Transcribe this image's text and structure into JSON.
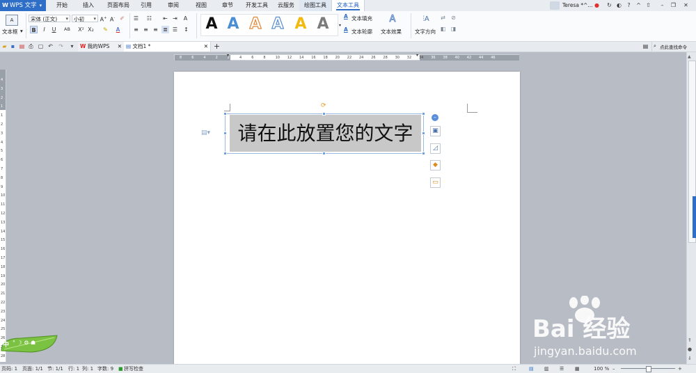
{
  "app": {
    "name": "WPS 文字",
    "user": "Teresa *^..."
  },
  "menu": [
    "开始",
    "插入",
    "页面布局",
    "引用",
    "审阅",
    "视图",
    "章节",
    "开发工具",
    "云服务",
    "绘图工具",
    "文本工具"
  ],
  "ribbon": {
    "textbox_label": "文本框",
    "font_name": "宋体 (正文)",
    "font_size": "小初",
    "text_fill": "文本填充",
    "text_outline": "文本轮廓",
    "text_effects": "文本效果",
    "text_direction": "文字方向",
    "style_letter": "A"
  },
  "tabs": {
    "mywps": "我的WPS",
    "doc": "文档1 *",
    "find": "点此查找命令"
  },
  "ruler_h": [
    "8",
    "6",
    "4",
    "2",
    "2",
    "4",
    "6",
    "8",
    "10",
    "12",
    "14",
    "16",
    "18",
    "20",
    "22",
    "24",
    "26",
    "28",
    "30",
    "32",
    "34",
    "36",
    "38",
    "40",
    "42",
    "44",
    "46"
  ],
  "ruler_v": [
    "4",
    "3",
    "2",
    "1",
    "1",
    "2",
    "3",
    "4",
    "5",
    "6",
    "7",
    "8",
    "9",
    "10",
    "11",
    "12",
    "13",
    "14",
    "15",
    "16",
    "17",
    "18",
    "19",
    "20",
    "21",
    "22",
    "23",
    "24",
    "25",
    "26",
    "27",
    "28"
  ],
  "document": {
    "textbox_text": "请在此放置您的文字"
  },
  "status": {
    "page": "页码: 1",
    "pages": "页面: 1/1",
    "section": "节: 1/1",
    "row": "行: 1",
    "col": "列: 1",
    "words": "字数: 9",
    "spell": "拼写检查",
    "zoom": "100 %"
  },
  "ime": "中",
  "watermark": {
    "brand": "Bai 经验",
    "url": "jingyan.baidu.com"
  },
  "colors": {
    "accent": "#2f6ec7",
    "textbox_fill": "#c8c8c8"
  }
}
